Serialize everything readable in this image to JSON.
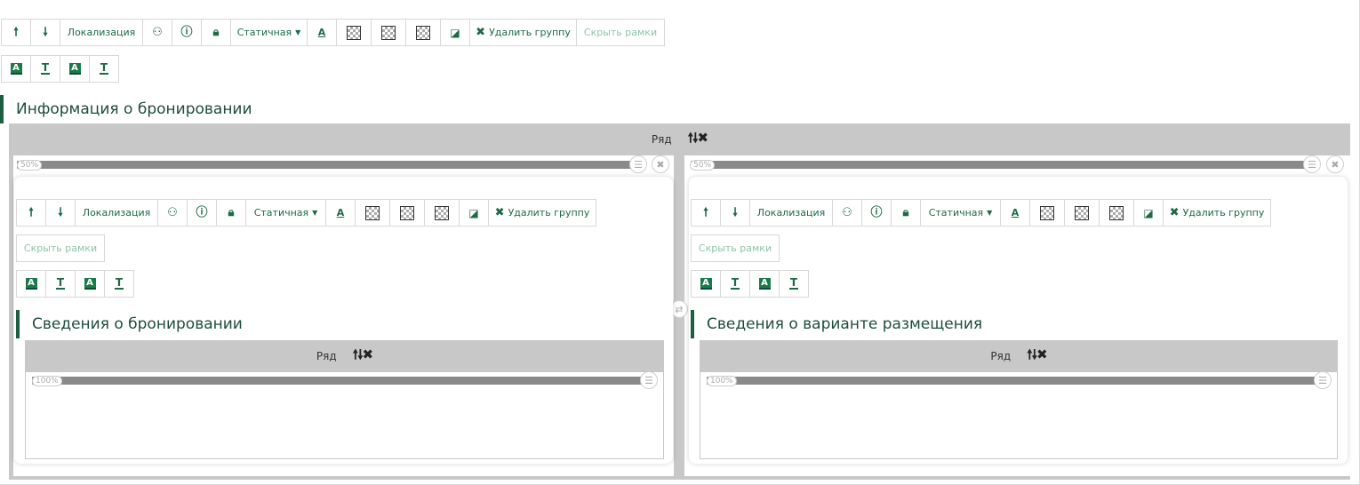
{
  "top_toolbar": {
    "up_icon": "arrow-up-icon",
    "down_icon": "arrow-down-icon",
    "localization": "Локализация",
    "binoculars_icon": "binoculars-icon",
    "info_icon": "info-icon",
    "lock_icon": "lock-icon",
    "position": "Статичная",
    "font_color_glyph": "A",
    "eraser_icon": "eraser-icon",
    "delete_group": "Удалить группу",
    "hide_frames": "Скрыть рамки"
  },
  "text_style_buttons": [
    "A",
    "T",
    "A",
    "T"
  ],
  "main_heading": "Информация о бронировании",
  "row_label": "Ряд",
  "row_arrows": "🠕🠗✖",
  "left_column": {
    "percent": "50%",
    "toolbar": {
      "localization": "Локализация",
      "position": "Статичная",
      "font_color_glyph": "A",
      "delete_group": "Удалить группу",
      "hide_frames": "Скрыть рамки"
    },
    "heading": "Сведения о бронировании",
    "row_label": "Ряд",
    "inner_percent": "100%"
  },
  "right_column": {
    "percent": "50%",
    "toolbar": {
      "localization": "Локализация",
      "position": "Статичная",
      "font_color_glyph": "A",
      "delete_group": "Удалить группу",
      "hide_frames": "Скрыть рамки"
    },
    "heading": "Сведения о варианте размещения",
    "row_label": "Ряд",
    "inner_percent": "100%"
  },
  "colors": {
    "accent": "#1b6b45",
    "row_bar": "#c8c8c8",
    "slider": "#8a8a8a"
  }
}
